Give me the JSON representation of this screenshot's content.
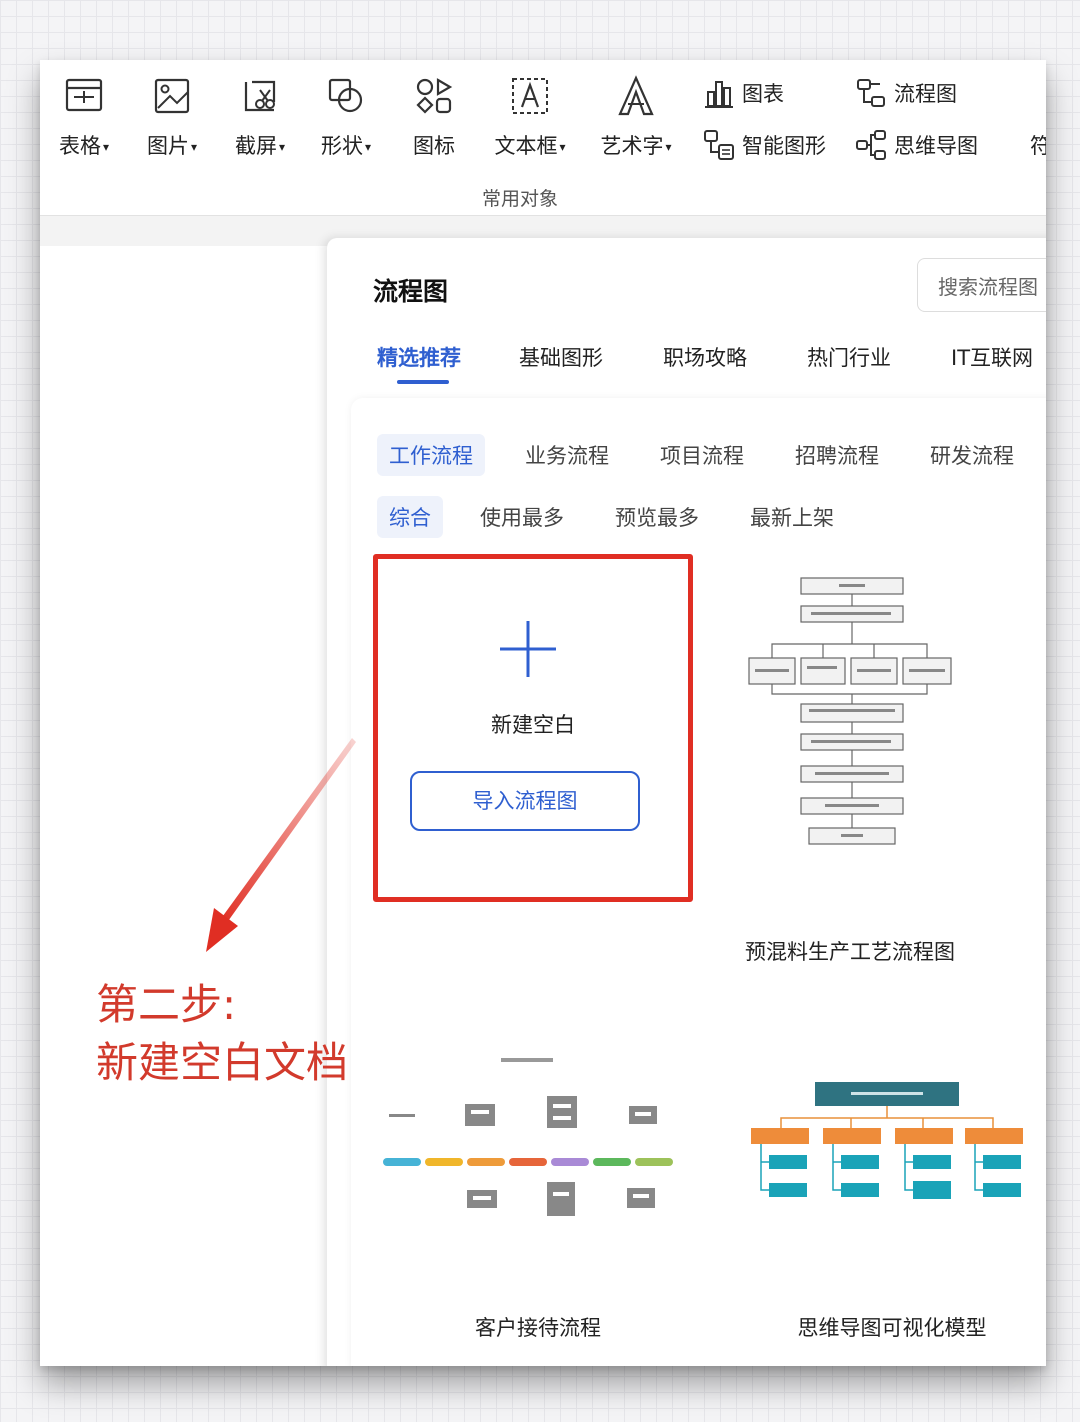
{
  "ribbon": {
    "items": [
      {
        "label": "表格",
        "icon": "table-icon",
        "dropdown": true
      },
      {
        "label": "图片",
        "icon": "image-icon",
        "dropdown": true
      },
      {
        "label": "截屏",
        "icon": "screenshot-icon",
        "dropdown": true
      },
      {
        "label": "形状",
        "icon": "shape-icon",
        "dropdown": true
      },
      {
        "label": "图标",
        "icon": "icons-icon",
        "dropdown": false
      },
      {
        "label": "文本框",
        "icon": "textbox-icon",
        "dropdown": true
      },
      {
        "label": "艺术字",
        "icon": "wordart-icon",
        "dropdown": true
      }
    ],
    "small_items": [
      {
        "label": "图表",
        "icon": "chart-icon"
      },
      {
        "label": "流程图",
        "icon": "flowchart-icon"
      },
      {
        "label": "智能图形",
        "icon": "smartart-icon"
      },
      {
        "label": "思维导图",
        "icon": "mindmap-icon"
      }
    ],
    "cut_off_label": "符",
    "group_label": "常用对象"
  },
  "panel": {
    "title": "流程图",
    "search_placeholder": "搜索流程图",
    "tabs": [
      "精选推荐",
      "基础图形",
      "职场攻略",
      "热门行业",
      "IT互联网"
    ],
    "active_tab": "精选推荐",
    "categories": [
      "工作流程",
      "业务流程",
      "项目流程",
      "招聘流程",
      "研发流程"
    ],
    "active_category": "工作流程",
    "sorts": [
      "综合",
      "使用最多",
      "预览最多",
      "最新上架"
    ],
    "active_sort": "综合",
    "new_blank": {
      "label": "新建空白",
      "import_label": "导入流程图"
    },
    "templates": [
      {
        "title": "预混料生产工艺流程图"
      },
      {
        "title": "客户接待流程"
      },
      {
        "title": "思维导图可视化模型"
      }
    ]
  },
  "annotation": {
    "line1": "第二步:",
    "line2": "新建空白文档",
    "color": "#d23a2c"
  },
  "colors": {
    "accent": "#2f5fd0",
    "highlight_border": "#e02e23"
  }
}
